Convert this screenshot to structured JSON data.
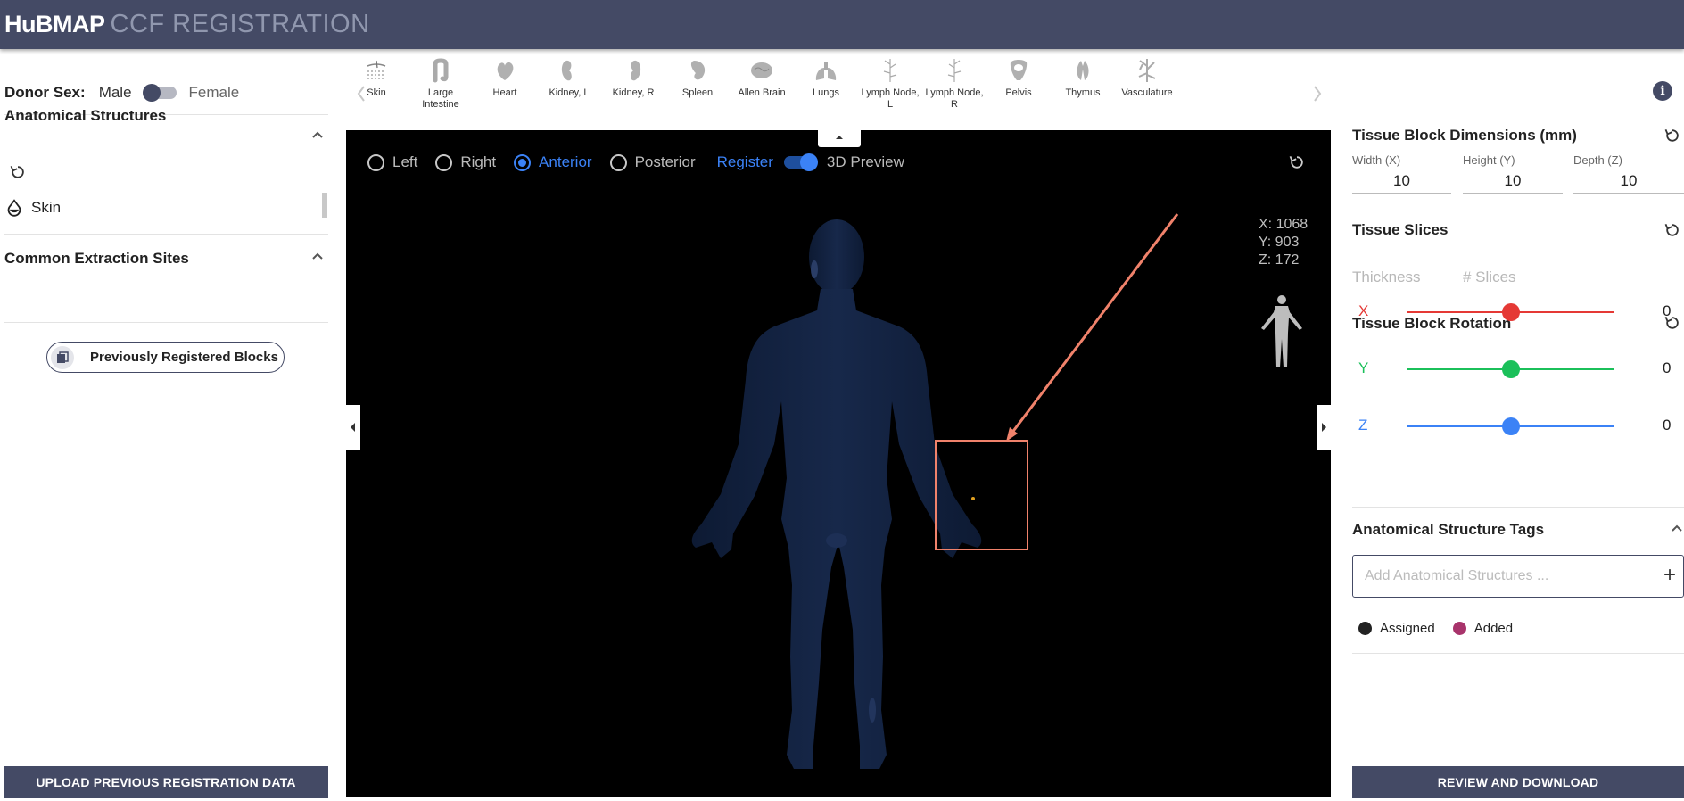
{
  "header": {
    "brand": "HuBMAP",
    "product": "CCF REGISTRATION"
  },
  "left_panel": {
    "donor_sex_label": "Donor Sex:",
    "male_label": "Male",
    "female_label": "Female",
    "donor_sex_value": "Male",
    "anatomical_structures_title": "Anatomical Structures",
    "structures": [
      {
        "label": "Skin",
        "icon": "drop-icon"
      }
    ],
    "extraction_sites_title": "Common Extraction Sites",
    "previously_registered_label": "Previously Registered Blocks",
    "upload_label": "UPLOAD PREVIOUS REGISTRATION DATA"
  },
  "organs": [
    {
      "label": "Skin",
      "icon": "skin-icon"
    },
    {
      "label": "Large Intestine",
      "icon": "large-intestine-icon"
    },
    {
      "label": "Heart",
      "icon": "heart-icon"
    },
    {
      "label": "Kidney, L",
      "icon": "kidney-left-icon"
    },
    {
      "label": "Kidney, R",
      "icon": "kidney-right-icon"
    },
    {
      "label": "Spleen",
      "icon": "spleen-icon"
    },
    {
      "label": "Allen Brain",
      "icon": "brain-icon"
    },
    {
      "label": "Lungs",
      "icon": "lungs-icon"
    },
    {
      "label": "Lymph Node, L",
      "icon": "lymph-node-left-icon"
    },
    {
      "label": "Lymph Node, R",
      "icon": "lymph-node-right-icon"
    },
    {
      "label": "Pelvis",
      "icon": "pelvis-icon"
    },
    {
      "label": "Thymus",
      "icon": "thymus-icon"
    },
    {
      "label": "Vasculature",
      "icon": "vasculature-icon"
    }
  ],
  "stage": {
    "views": [
      {
        "label": "Left",
        "selected": false
      },
      {
        "label": "Right",
        "selected": false
      },
      {
        "label": "Anterior",
        "selected": true
      },
      {
        "label": "Posterior",
        "selected": false
      }
    ],
    "register_label": "Register",
    "preview_label": "3D Preview",
    "preview_enabled": true,
    "coords": {
      "x": "X: 1068",
      "y": "Y: 903",
      "z": "Z: 172"
    },
    "annotation_color": "#f0826b"
  },
  "right_panel": {
    "dimensions_title": "Tissue Block Dimensions (mm)",
    "width_label": "Width (X)",
    "width_value": "10",
    "height_label": "Height (Y)",
    "height_value": "10",
    "depth_label": "Depth (Z)",
    "depth_value": "10",
    "slices_title": "Tissue Slices",
    "thickness_placeholder": "Thickness",
    "slices_placeholder": "# Slices",
    "rotation_title": "Tissue Block Rotation",
    "rotations": [
      {
        "axis": "X",
        "value": "0",
        "color": "#e53935",
        "fraction": 0.5
      },
      {
        "axis": "Y",
        "value": "0",
        "color": "#1bc05a",
        "fraction": 0.5
      },
      {
        "axis": "Z",
        "value": "0",
        "color": "#3b82f6",
        "fraction": 0.5
      }
    ],
    "tags_title": "Anatomical Structure Tags",
    "tags_placeholder": "Add Anatomical Structures ...",
    "legend_assigned": "Assigned",
    "legend_added": "Added",
    "assigned_color": "#222222",
    "added_color": "#a8336b",
    "review_label": "REVIEW AND DOWNLOAD"
  }
}
